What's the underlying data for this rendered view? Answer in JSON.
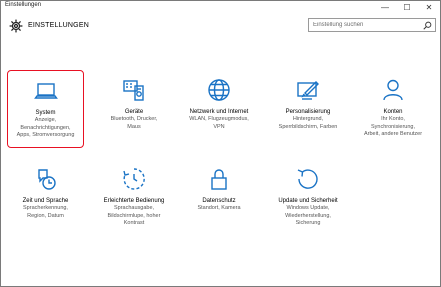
{
  "window": {
    "title": "Einstellungen",
    "controls": [
      "—",
      "☐",
      "✕"
    ]
  },
  "header": {
    "title": "EINSTELLUNGEN",
    "search_placeholder": "Einstellung suchen"
  },
  "tiles": [
    {
      "name": "System",
      "sub": [
        "Anzeige,",
        "Benachrichtigungen,",
        "Apps, Stromversorgung"
      ],
      "icon": "laptop-icon",
      "selected": true
    },
    {
      "name": "Geräte",
      "sub": [
        "Bluetooth, Drucker,",
        "Maus"
      ],
      "icon": "devices-icon",
      "selected": false
    },
    {
      "name": "Netzwerk und Internet",
      "sub": [
        "WLAN, Flugzeugmodus,",
        "VPN"
      ],
      "icon": "globe-icon",
      "selected": false
    },
    {
      "name": "Personalisierung",
      "sub": [
        "Hintergrund,",
        "Sperrbildschirm, Farben"
      ],
      "icon": "paint-icon",
      "selected": false
    },
    {
      "name": "Konten",
      "sub": [
        "Ihr Konto,",
        "Synchronisierung,",
        "Arbeit, andere Benutzer"
      ],
      "icon": "person-icon",
      "selected": false
    },
    {
      "name": "Zeit und Sprache",
      "sub": [
        "Spracherkennung,",
        "Region, Datum"
      ],
      "icon": "time-language-icon",
      "selected": false
    },
    {
      "name": "Erleichterte Bedienung",
      "sub": [
        "Sprachausgabe,",
        "Bildschirmlupe, hoher",
        "Kontrast"
      ],
      "icon": "ease-of-access-icon",
      "selected": false
    },
    {
      "name": "Datenschutz",
      "sub": [
        "Standort, Kamera"
      ],
      "icon": "lock-icon",
      "selected": false
    },
    {
      "name": "Update und Sicherheit",
      "sub": [
        "Windows Update,",
        "Wiederherstellung,",
        "Sicherung"
      ],
      "icon": "update-icon",
      "selected": false
    }
  ],
  "colors": {
    "accent": "#1a73c5",
    "selection": "#e81123"
  }
}
